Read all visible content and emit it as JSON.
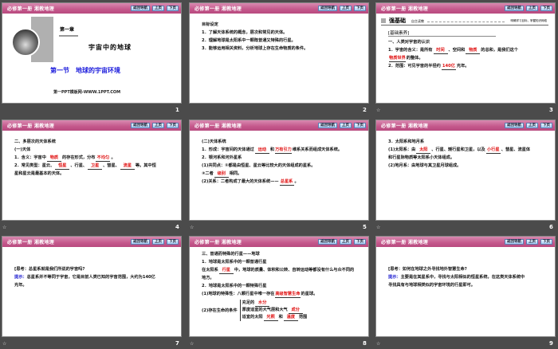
{
  "header": {
    "title": "必修第一册 湘教地理",
    "buttons": [
      "返回导航",
      "上页",
      "下页"
    ]
  },
  "slides": [
    {
      "num": "1",
      "chapter": "第一章",
      "title": "宇宙中的地球",
      "section": "第一节　地球的宇宙环境",
      "url": "第一PPT模板网-WWW.1PPT.COM"
    },
    {
      "num": "2",
      "lines": [
        [
          {
            "t": "目标设定"
          }
        ],
        [
          {
            "t": "1．了解天体系统的概念，层次和常见的天体。"
          }
        ],
        [
          {
            "t": "2．理解地球是太阳系中一颗既普通又特殊的行星。"
          }
        ],
        [
          {
            "t": "3．能够运用相关资料，分析地球上存在生命物质的条件。"
          }
        ]
      ]
    },
    {
      "num": "3",
      "bar": {
        "a": "强基础",
        "b": "自主读教",
        "c": "明确学习目标，掌握知识网络"
      },
      "tag": "[基础素养]",
      "lines": [
        [
          {
            "t": "一、人类对宇宙的认识"
          }
        ],
        [
          {
            "t": "1．宇宙的含义：是所有"
          },
          {
            "b": "时间"
          },
          {
            "t": "、空间和"
          },
          {
            "b": "物质"
          },
          {
            "t": "的总和，是我们这个"
          }
        ],
        [
          {
            "b": "物质世界"
          },
          {
            "t": "的整体。"
          }
        ],
        [
          {
            "t": "2．范围：可见宇宙的半径约"
          },
          {
            "b": "140亿"
          },
          {
            "t": "光年。"
          }
        ]
      ]
    },
    {
      "num": "4",
      "lines": [
        [
          {
            "t": "二、多层次的天体系统"
          }
        ],
        [
          {
            "t": "(一)天体"
          }
        ],
        [
          {
            "t": "1．含义：宇宙中"
          },
          {
            "b": "物质"
          },
          {
            "t": "的存在形式，分布"
          },
          {
            "b": "不均匀"
          },
          {
            "t": "。"
          }
        ],
        [
          {
            "t": "2．常见类型：星云、"
          },
          {
            "b": "恒星"
          },
          {
            "t": "、行星、"
          },
          {
            "b": "卫星"
          },
          {
            "t": "、彗星、"
          },
          {
            "b": "流星"
          },
          {
            "t": "等。其中恒"
          }
        ],
        [
          {
            "t": "星和星云是最基本的天体。"
          }
        ]
      ]
    },
    {
      "num": "5",
      "lines": [
        [
          {
            "t": "(二)天体系统"
          }
        ],
        [
          {
            "t": "1．形成：宇宙间的天体通过"
          },
          {
            "b": "运动"
          },
          {
            "t": "和"
          },
          {
            "b": "万有引力"
          },
          {
            "t": "维系关系而组成天体系统。"
          }
        ],
        [
          {
            "t": "2．银河系和河外星系"
          }
        ],
        [
          {
            "t": "(1)共同点：①都是由恒星、星云等比较大的天体组成的星系。"
          }
        ],
        [
          {
            "t": "②二者"
          },
          {
            "b": "级别"
          },
          {
            "t": "相同。"
          }
        ],
        [
          {
            "t": "(2)关系：二者构成了最大的天体系统——"
          },
          {
            "b": "总星系"
          },
          {
            "t": "。"
          }
        ]
      ]
    },
    {
      "num": "6",
      "lines": [
        [
          {
            "t": "3．太阳系和地月系"
          }
        ],
        [
          {
            "t": "(1)太阳系：由"
          },
          {
            "b": "太阳"
          },
          {
            "t": "、行星、矮行星和卫星，以及"
          },
          {
            "b": "小行星"
          },
          {
            "t": "、彗星、流星体"
          }
        ],
        [
          {
            "t": "和行星际物质等太阳系小天体组成。"
          }
        ],
        [
          {
            "t": "(2)地月系：由地球与其卫星月球组成。"
          }
        ]
      ]
    },
    {
      "num": "7",
      "lines": [
        [
          {
            "t": "[思考：总星系就是我们所说的宇宙吗?"
          }
        ],
        [
          {
            "tip": "提示："
          },
          {
            "t": "总星系并不等同于宇宙，它是目前人类已知的宇宙范围，大约为140亿"
          }
        ],
        [
          {
            "t": "光年。"
          }
        ]
      ]
    },
    {
      "num": "8",
      "lines": [
        [
          {
            "t": "三、普通而特殊的行星——地球"
          }
        ],
        [
          {
            "t": "1．地球是太阳系中的一颗普通行星"
          }
        ],
        [
          {
            "t": "在太阳系"
          },
          {
            "b": "行星"
          },
          {
            "t": "中，地球的质量、体积和公转、自转运动等都没有什么与众不同的"
          }
        ],
        [
          {
            "t": "地方。"
          }
        ],
        [
          {
            "t": "2．地球是太阳系中的一颗特殊行星"
          }
        ],
        [
          {
            "t": "(1)地球的特殊性：八颗行星中唯一存在"
          },
          {
            "b": "高级智慧生命"
          },
          {
            "t": "的星球。"
          }
        ]
      ],
      "cond": {
        "label": "(2)存在生命的条件",
        "items": [
          [
            {
              "t": "充足的"
            },
            {
              "b": "水分"
            }
          ],
          [
            {
              "t": "厚度适宜的大气层和大气"
            },
            {
              "b": "成分"
            }
          ],
          [
            {
              "t": "适宜的太阳"
            },
            {
              "b": "光照"
            },
            {
              "t": "和"
            },
            {
              "b": "温度"
            },
            {
              "t": "范围"
            }
          ]
        ]
      }
    },
    {
      "num": "9",
      "lines": [
        [
          {
            "t": "[思考：如何在地球之外寻找地外智慧生命?"
          }
        ],
        [
          {
            "tip": "提示："
          },
          {
            "t": "主要是在其星系中，寻找与太阳相似的恒星系统，在这类天体系统中"
          }
        ],
        [
          {
            "t": "寻找具有与地球相类似的宇宙环境的行星即可。"
          }
        ]
      ]
    }
  ]
}
